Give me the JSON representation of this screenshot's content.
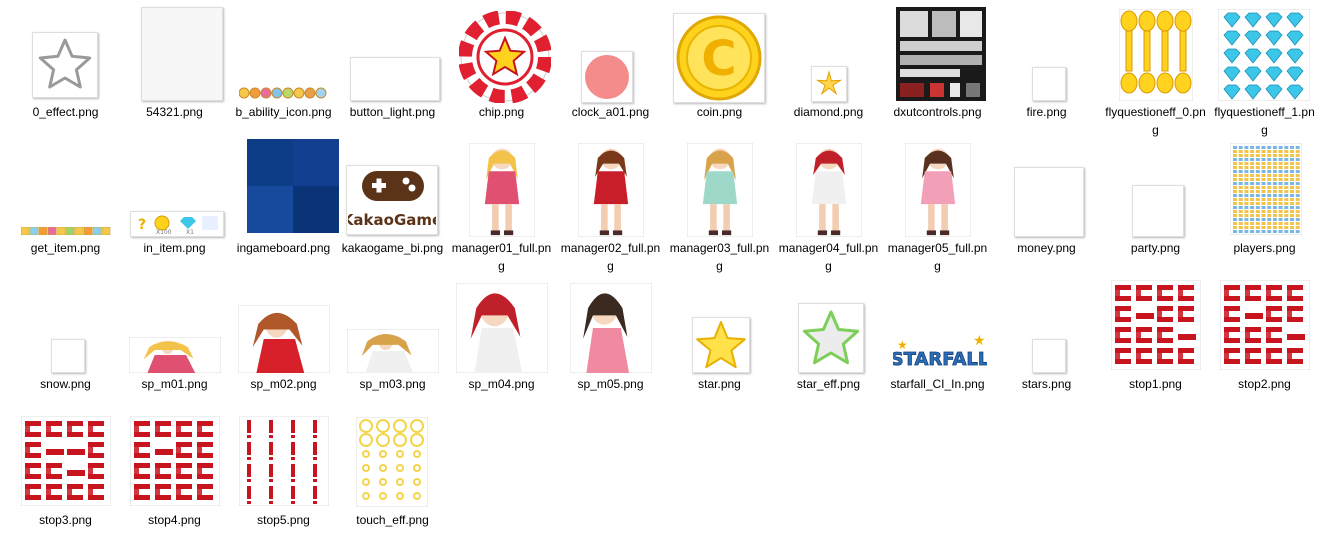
{
  "window": {
    "view": "large-icons"
  },
  "files": [
    {
      "name": "0_effect.png",
      "icon": "star-outline-icon"
    },
    {
      "name": "54321.png",
      "icon": "number-sprite-thumbnail"
    },
    {
      "name": "b_ability_icon.png",
      "icon": "ability-icons-strip-thumbnail"
    },
    {
      "name": "button_light.png",
      "icon": "blank-thumbnail"
    },
    {
      "name": "chip.png",
      "icon": "casino-chip-icon"
    },
    {
      "name": "clock_a01.png",
      "icon": "pink-circle-icon"
    },
    {
      "name": "coin.png",
      "icon": "gold-coin-icon"
    },
    {
      "name": "diamond.png",
      "icon": "sparkle-icon"
    },
    {
      "name": "dxutcontrols.png",
      "icon": "ui-controls-sprite-thumbnail"
    },
    {
      "name": "fire.png",
      "icon": "blank-thumbnail"
    },
    {
      "name": "flyquestioneff_0.png",
      "icon": "coin-animation-sprite-thumbnail"
    },
    {
      "name": "flyquestioneff_1.png",
      "icon": "diamond-grid-sprite-thumbnail"
    },
    {
      "name": "get_item.png",
      "icon": "item-strip-thumbnail"
    },
    {
      "name": "in_item.png",
      "icon": "in-item-thumbnail"
    },
    {
      "name": "ingameboard.png",
      "icon": "blue-board-thumbnail"
    },
    {
      "name": "kakaogame_bi.png",
      "icon": "kakaogame-logo",
      "logo_text": "KakaoGame"
    },
    {
      "name": "manager01_full.png",
      "icon": "character-figure"
    },
    {
      "name": "manager02_full.png",
      "icon": "character-figure"
    },
    {
      "name": "manager03_full.png",
      "icon": "character-figure"
    },
    {
      "name": "manager04_full.png",
      "icon": "character-figure"
    },
    {
      "name": "manager05_full.png",
      "icon": "character-figure"
    },
    {
      "name": "money.png",
      "icon": "blank-thumbnail"
    },
    {
      "name": "party.png",
      "icon": "blank-thumbnail"
    },
    {
      "name": "players.png",
      "icon": "player-sprite-columns-thumbnail"
    },
    {
      "name": "snow.png",
      "icon": "blank-thumbnail"
    },
    {
      "name": "sp_m01.png",
      "icon": "character-pose-thumbnail"
    },
    {
      "name": "sp_m02.png",
      "icon": "character-pose-thumbnail"
    },
    {
      "name": "sp_m03.png",
      "icon": "character-pose-thumbnail"
    },
    {
      "name": "sp_m04.png",
      "icon": "character-pose-thumbnail"
    },
    {
      "name": "sp_m05.png",
      "icon": "character-pose-thumbnail"
    },
    {
      "name": "star.png",
      "icon": "yellow-star-icon"
    },
    {
      "name": "star_eff.png",
      "icon": "white-star-icon"
    },
    {
      "name": "starfall_CI_In.png",
      "icon": "starfall-logo",
      "logo_text": "STARFALL"
    },
    {
      "name": "stars.png",
      "icon": "blank-thumbnail"
    },
    {
      "name": "stop1.png",
      "icon": "red-text-sprite-thumbnail"
    },
    {
      "name": "stop2.png",
      "icon": "red-text-sprite-thumbnail"
    },
    {
      "name": "stop3.png",
      "icon": "red-text-sprite-thumbnail"
    },
    {
      "name": "stop4.png",
      "icon": "red-text-sprite-thumbnail"
    },
    {
      "name": "stop5.png",
      "icon": "red-exclamation-sprite-thumbnail"
    },
    {
      "name": "touch_eff.png",
      "icon": "yellow-ring-sprite-thumbnail"
    }
  ],
  "colors": {
    "coin_gold": "#ffd21e",
    "chip_red": "#e02030",
    "board_blue": "#0d3d87",
    "kakao_brown": "#5a3319",
    "starfall_blue": "#2b6fb8",
    "pink_circle": "#f48c8c",
    "sprite_red": "#c8141e"
  }
}
